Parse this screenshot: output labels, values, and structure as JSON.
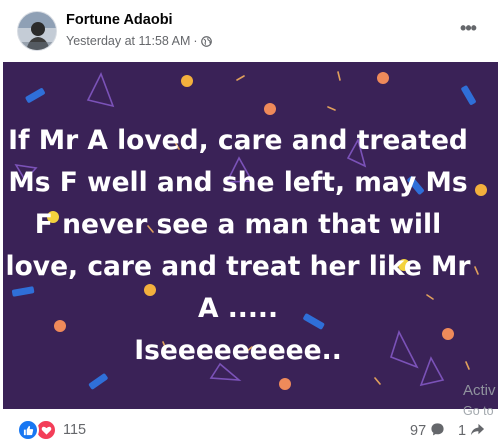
{
  "post": {
    "author": "Fortune Adaobi",
    "timestamp": "Yesterday at 11:58 AM",
    "separator": "·",
    "privacy_icon": "globe-icon",
    "more_icon": "more-options-icon",
    "more_label": "•••"
  },
  "image": {
    "background": "#3a2257",
    "lines": [
      "If Mr A loved, care and treated",
      "Ms F well and she left, may Ms",
      "F never see a man that will",
      "love, care and treat her like Mr",
      "A .....",
      "Iseeeeeeeee.."
    ],
    "watermark_line1": "Activ",
    "watermark_line2": "Go to"
  },
  "footer": {
    "reaction_icons": [
      "like-icon",
      "love-icon"
    ],
    "reaction_count": "115",
    "comment_count": "97",
    "share_count": "1"
  },
  "colors": {
    "like": "#1877f2",
    "love": "#f33e58",
    "text_secondary": "#65676b",
    "name": "#050505"
  }
}
